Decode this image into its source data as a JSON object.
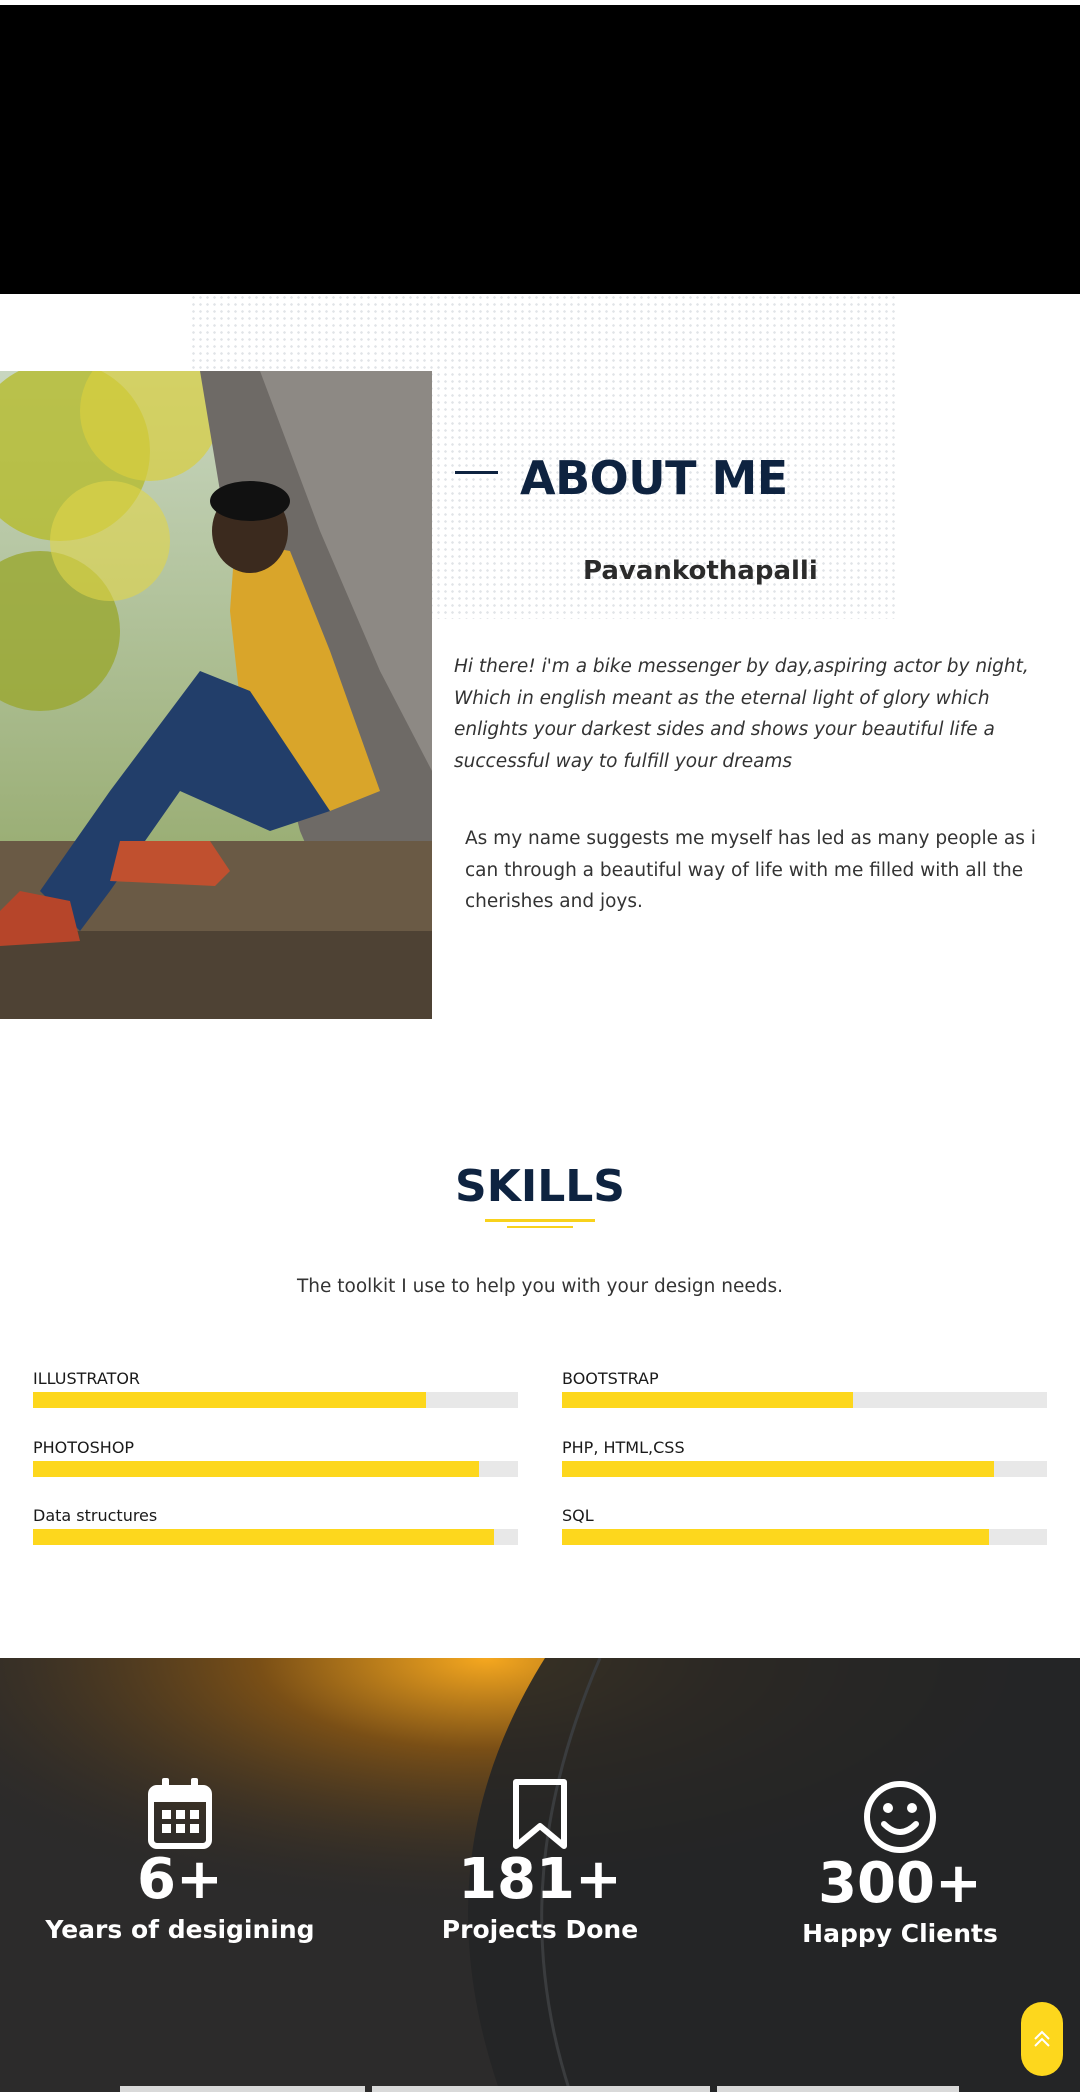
{
  "about": {
    "title": "ABOUT ME",
    "name": "Pavankothapalli",
    "paragraph1": "Hi there! i'm a bike messenger by day,aspiring actor by night, Which in english meant as the eternal light of glory which enlights your darkest sides and shows your beautiful life a successful way to fulfill your dreams",
    "paragraph2": "As my name suggests me myself has led as many people as i can through a beautiful way of life with me filled with all the cherishes and joys."
  },
  "skills": {
    "title": "SKILLS",
    "subtitle": "The toolkit I use to help you with your design needs.",
    "items": [
      {
        "label": "ILLUSTRATOR",
        "level": 81
      },
      {
        "label": "BOOTSTRAP",
        "level": 60
      },
      {
        "label": "PHOTOSHOP",
        "level": 92
      },
      {
        "label": "PHP, HTML,CSS",
        "level": 89
      },
      {
        "label": "Data structures",
        "level": 95
      },
      {
        "label": "SQL",
        "level": 88
      }
    ],
    "accent_color": "#fdd71d"
  },
  "stats": {
    "items": [
      {
        "icon": "calendar-icon",
        "value": "6+",
        "label": "Years of desigining"
      },
      {
        "icon": "bookmark-icon",
        "value": "181+",
        "label": "Projects Done"
      },
      {
        "icon": "smiley-icon",
        "value": "300+",
        "label": "Happy Clients"
      }
    ]
  },
  "scroll_top": {
    "icon": "double-chevron-up-icon"
  }
}
